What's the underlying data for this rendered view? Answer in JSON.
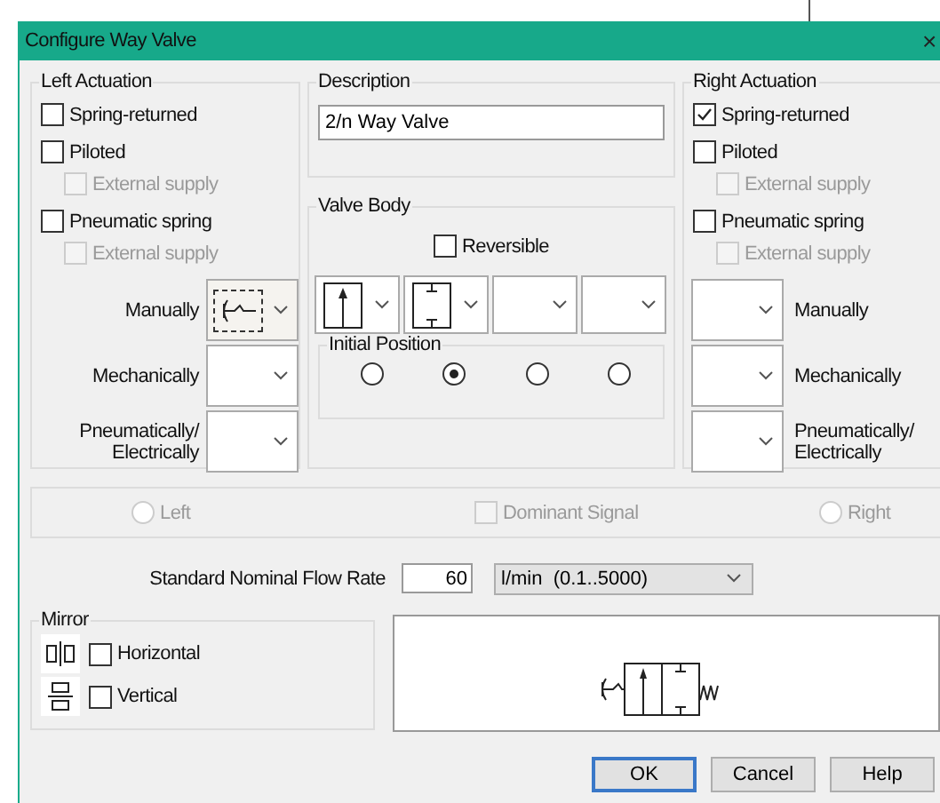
{
  "window": {
    "title": "Configure Way Valve",
    "close": "×"
  },
  "left_actuation": {
    "title": "Left Actuation",
    "options": [
      {
        "label": "Spring-returned",
        "checked": false,
        "disabled": false
      },
      {
        "label": "Piloted",
        "checked": false,
        "disabled": false,
        "children": [
          {
            "label": "External supply",
            "checked": false,
            "disabled": true
          }
        ]
      },
      {
        "label": "Pneumatic spring",
        "checked": false,
        "disabled": false,
        "children": [
          {
            "label": "External supply",
            "checked": false,
            "disabled": true
          }
        ]
      }
    ],
    "actuators": [
      {
        "label": "Manually",
        "kind": "lever",
        "focused": true
      },
      {
        "label": "Mechanically",
        "focused": false
      },
      {
        "label": "Pneumatically/\nElectrically",
        "focused": false
      }
    ]
  },
  "description": {
    "title": "Description",
    "value": "2/n Way Valve"
  },
  "valve_body": {
    "title": "Valve Body",
    "reversible": {
      "label": "Reversible",
      "checked": false
    },
    "positions": [
      {
        "kind": "flow"
      },
      {
        "kind": "blocked"
      },
      {
        "kind": "empty"
      },
      {
        "kind": "empty"
      }
    ],
    "initial_position": {
      "title": "Initial Position",
      "options": [
        {
          "selected": false
        },
        {
          "selected": true
        },
        {
          "selected": false
        },
        {
          "selected": false
        }
      ]
    }
  },
  "right_actuation": {
    "title": "Right Actuation",
    "options": [
      {
        "label": "Spring-returned",
        "checked": true,
        "disabled": false
      },
      {
        "label": "Piloted",
        "checked": false,
        "disabled": false,
        "children": [
          {
            "label": "External supply",
            "checked": false,
            "disabled": true
          }
        ]
      },
      {
        "label": "Pneumatic spring",
        "checked": false,
        "disabled": false,
        "children": [
          {
            "label": "External supply",
            "checked": false,
            "disabled": true
          }
        ]
      }
    ],
    "actuators": [
      {
        "label": "Manually",
        "focused": false
      },
      {
        "label": "Mechanically",
        "focused": false
      },
      {
        "label": "Pneumatically/\nElectrically",
        "focused": false
      }
    ]
  },
  "signal": {
    "options": [
      {
        "kind": "radio",
        "label": "Left",
        "selected": false,
        "disabled": true
      },
      {
        "kind": "checkbox",
        "label": "Dominant Signal",
        "checked": false,
        "disabled": true
      },
      {
        "kind": "radio",
        "label": "Right",
        "selected": false,
        "disabled": true
      }
    ]
  },
  "flow_rate": {
    "label": "Standard Nominal Flow Rate",
    "value": "60",
    "unit": "l/min  (0.1..5000)"
  },
  "mirror": {
    "title": "Mirror",
    "options": [
      {
        "kind": "horizontal",
        "label": "Horizontal",
        "checked": false
      },
      {
        "kind": "vertical",
        "label": "Vertical",
        "checked": false
      }
    ]
  },
  "buttons": [
    {
      "label": "OK",
      "default": true
    },
    {
      "label": "Cancel",
      "default": false
    },
    {
      "label": "Help",
      "default": false
    }
  ]
}
